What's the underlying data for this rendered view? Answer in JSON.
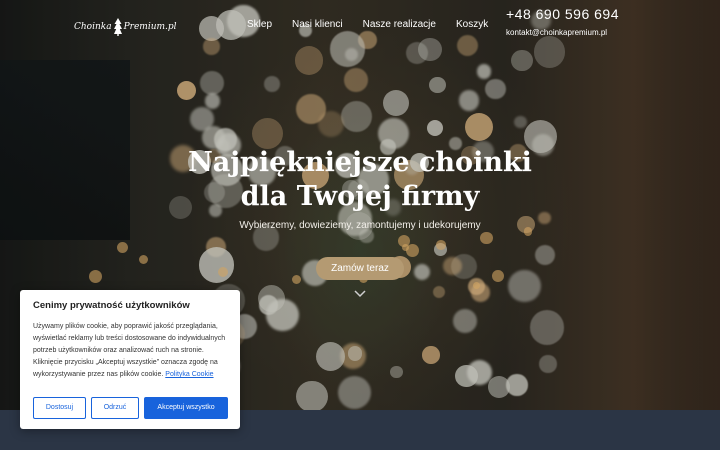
{
  "brand": {
    "logo_text_left": "Choinka",
    "logo_text_right": "Premium.pl"
  },
  "nav": {
    "items": [
      "Sklep",
      "Nasi klienci",
      "Nasze realizacje",
      "Koszyk"
    ]
  },
  "contact": {
    "phone": "+48 690 596 694",
    "email": "kontakt@choinkapremium.pl"
  },
  "hero": {
    "title_line1": "Najpiękniejsze choinki",
    "title_line2": "dla Twojej firmy",
    "subtitle": "Wybierzemy, dowieziemy, zamontujemy i udekorujemy",
    "cta_label": "Zamów teraz",
    "scroll_icon": "chevron-down-icon"
  },
  "cookie_banner": {
    "title": "Cenimy prywatność użytkowników",
    "text": "Używamy plików cookie, aby poprawić jakość przeglądania, wyświetlać reklamy lub treści dostosowane do indywidualnych potrzeb użytkowników oraz analizować ruch na stronie. Kliknięcie przycisku „Akceptuj wszystkie” oznacza zgodę na wykorzystywanie przez nas plików cookie.",
    "policy_link": "Polityka Cookie",
    "buttons": {
      "customize": "Dostosuj",
      "reject": "Odrzuć",
      "accept": "Akceptuj wszystko"
    }
  },
  "colors": {
    "accent_gold": "#b49a72",
    "cookie_blue": "#1863dc",
    "footer_band": "#2b3545"
  }
}
